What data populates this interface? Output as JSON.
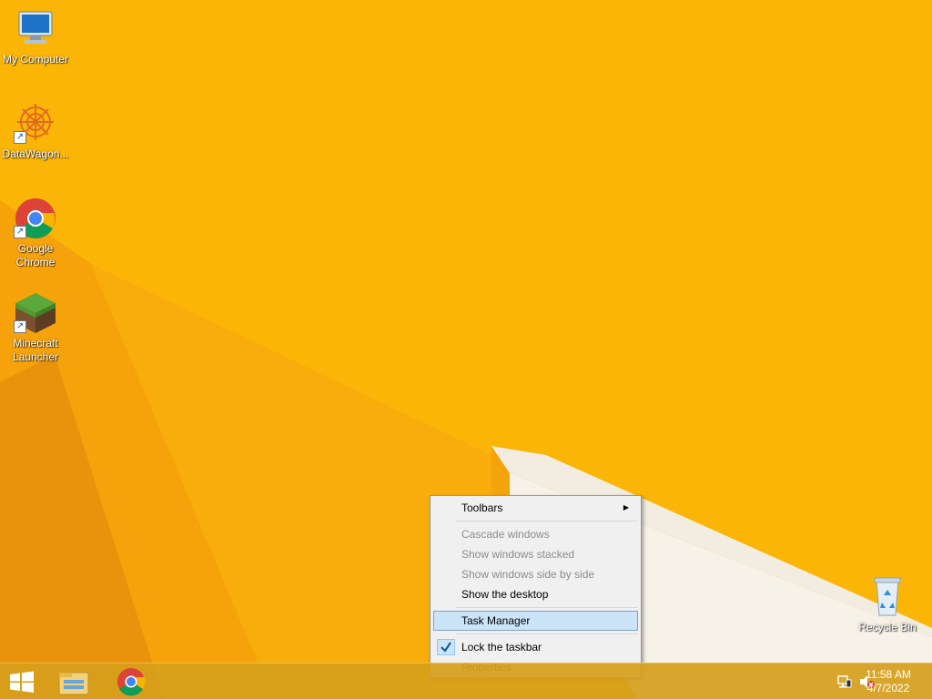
{
  "desktop_icons": [
    {
      "id": "my-computer",
      "label": "My Computer"
    },
    {
      "id": "datawagon",
      "label": "DataWagon..."
    },
    {
      "id": "google-chrome",
      "label": "Google Chrome"
    },
    {
      "id": "minecraft-launcher",
      "label": "Minecraft Launcher"
    },
    {
      "id": "recycle-bin",
      "label": "Recycle Bin"
    }
  ],
  "context_menu": {
    "toolbars": "Toolbars",
    "cascade": "Cascade windows",
    "stacked": "Show windows stacked",
    "side_by_side": "Show windows side by side",
    "show_desktop": "Show the desktop",
    "task_manager": "Task Manager",
    "lock_taskbar": "Lock the taskbar",
    "properties": "Properties"
  },
  "clock": {
    "time": "11:58 AM",
    "date": "4/7/2022"
  },
  "colors": {
    "wallpaper": "#fbb507",
    "menu_highlight": "#cce4f7"
  },
  "icons": {
    "start": "windows-logo-icon",
    "explorer": "file-explorer-icon",
    "chrome": "chrome-icon",
    "network": "network-icon",
    "volume": "volume-muted-icon"
  }
}
